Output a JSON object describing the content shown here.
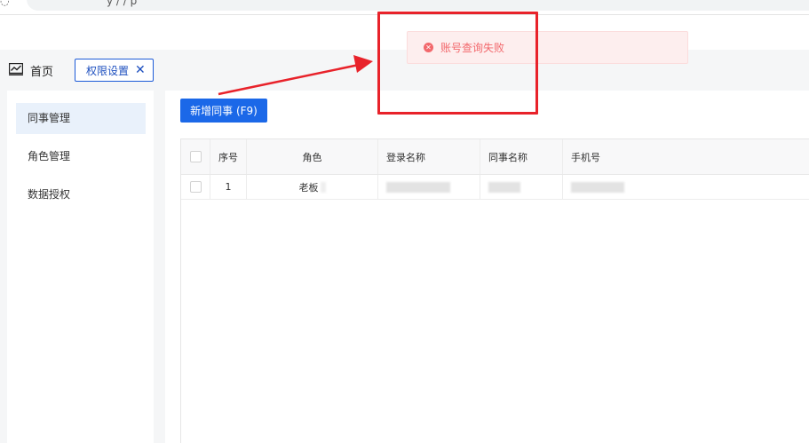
{
  "browser": {
    "address_partial": "y   /   /   p"
  },
  "nav": {
    "home_label": "首页",
    "active_tab_label": "权限设置",
    "tab_close_glyph": "✕"
  },
  "sidebar": {
    "items": [
      {
        "label": "同事管理",
        "active": true
      },
      {
        "label": "角色管理",
        "active": false
      },
      {
        "label": "数据授权",
        "active": false
      }
    ]
  },
  "toolbar": {
    "add_label": "新增同事 (F9)"
  },
  "table": {
    "columns": [
      "序号",
      "角色",
      "登录名称",
      "同事名称",
      "手机号"
    ],
    "rows": [
      {
        "index": "1",
        "role": "老板",
        "login_name": "",
        "colleague_name": "",
        "phone": ""
      }
    ]
  },
  "toast": {
    "message": "账号查询失败",
    "icon": "error-circle-icon",
    "color": "#f2686c"
  },
  "annotation": {
    "color": "#e8222a"
  },
  "colors": {
    "primary": "#1b68e8",
    "tab_border": "#1d5bd8",
    "sidebar_active": "#e9f1fb"
  }
}
